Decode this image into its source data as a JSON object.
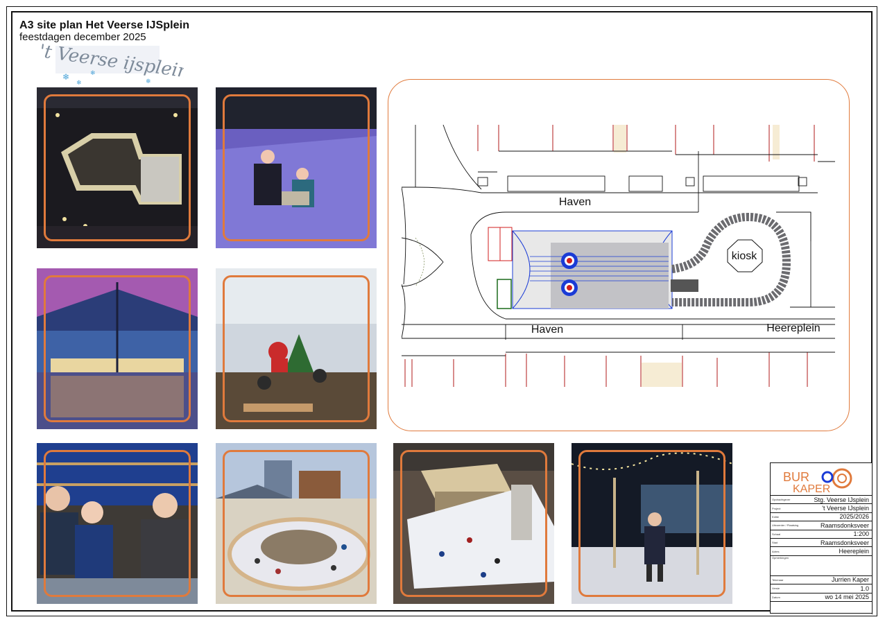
{
  "header": {
    "title": "A3 site plan Het Veerse IJSplein",
    "subtitle": "feestdagen december 2025",
    "logo_text": "'t Veerse ijsplein"
  },
  "photos": [
    {
      "name": "aerial-night-rink-photo"
    },
    {
      "name": "skaters-under-tent-photo"
    },
    {
      "name": "tent-interior-reflection-photo"
    },
    {
      "name": "santa-christmas-tree-photo"
    },
    {
      "name": "skate-rental-group-photo"
    },
    {
      "name": "rink-daytime-overview-photo"
    },
    {
      "name": "rink-with-pavilion-photo"
    },
    {
      "name": "skater-evening-lights-photo"
    }
  ],
  "plan": {
    "street_top": "Haven",
    "street_bottom": "Haven",
    "street_right": "Heereplein",
    "kiosk_label": "kiosk"
  },
  "title_block": {
    "logo_text": "BURO KAPER",
    "rows": [
      {
        "key": "Opdrachtgever",
        "value": "Stg. Veerse IJsplein"
      },
      {
        "key": "Project",
        "value": "'t Veerse IJsplein"
      },
      {
        "key": "Editie",
        "value": "2025/2026"
      },
      {
        "key": "Uitvoerder / Plaatsing",
        "value": "Raamsdonksveer"
      },
      {
        "key": "Schaal",
        "value": "1:200"
      },
      {
        "key": "Stad",
        "value": "Raamsdonksveer"
      },
      {
        "key": "Adres",
        "value": "Heereplein"
      },
      {
        "key": "Opmerkingen",
        "value": ""
      },
      {
        "key": "Tekenaar",
        "value": "Jurrien Kaper"
      },
      {
        "key": "Versie",
        "value": "1.0"
      },
      {
        "key": "Datum",
        "value": "wo 14 mei 2025"
      }
    ]
  },
  "colors": {
    "accent_orange": "#e07a3c",
    "rink_blue": "#1a3bd6",
    "building_red": "#b01a1a",
    "frame_black": "#111111"
  }
}
